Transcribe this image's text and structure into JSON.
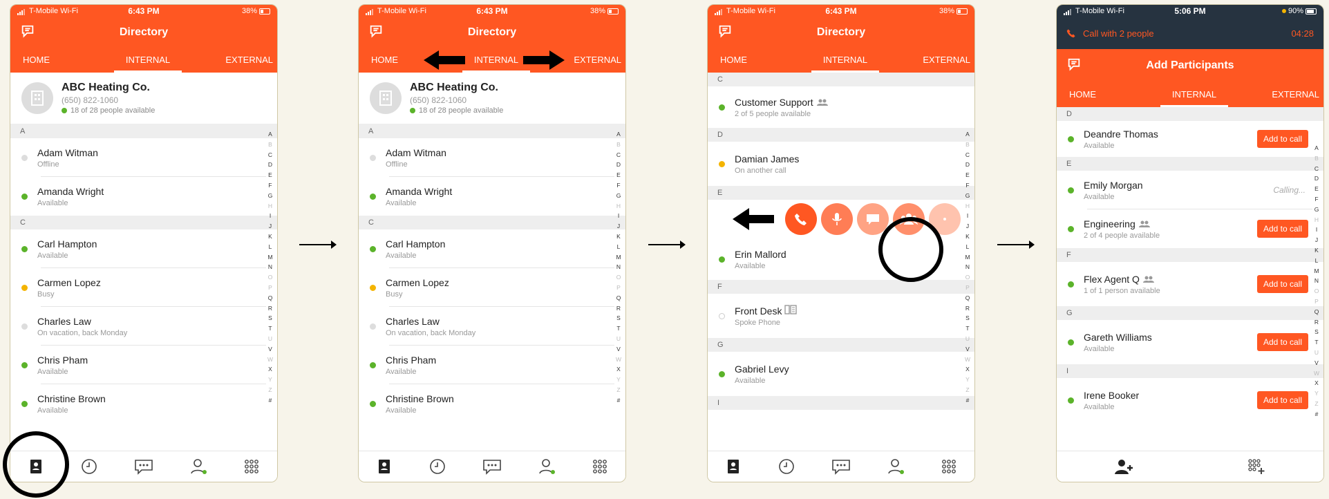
{
  "colors": {
    "accent": "#ff5722",
    "available": "#5bb32a",
    "busy": "#f4b400",
    "offline": "#dddddd",
    "call_bar": "#263340"
  },
  "status_bar": {
    "carrier": "T-Mobile Wi-Fi",
    "time": "6:43 PM",
    "battery": "38%"
  },
  "status_bar_4": {
    "carrier": "T-Mobile Wi-Fi",
    "time": "5:06 PM",
    "battery": "90%"
  },
  "directory": {
    "title": "Directory"
  },
  "tabs": {
    "home": "HOME",
    "internal": "INTERNAL",
    "external": "EXTERNAL"
  },
  "org": {
    "name": "ABC Heating Co.",
    "phone": "(650) 822-1060",
    "availability": "18 of 28 people available"
  },
  "alphabet": [
    "A",
    "B",
    "C",
    "D",
    "E",
    "F",
    "G",
    "H",
    "I",
    "J",
    "K",
    "L",
    "M",
    "N",
    "O",
    "P",
    "Q",
    "R",
    "S",
    "T",
    "U",
    "V",
    "W",
    "X",
    "Y",
    "Z",
    "#"
  ],
  "screen1_contacts": {
    "section_a": "A",
    "section_c": "C",
    "rows": [
      {
        "name": "Adam Witman",
        "status": "Offline"
      },
      {
        "name": "Amanda Wright",
        "status": "Available"
      },
      {
        "name": "Carl Hampton",
        "status": "Available"
      },
      {
        "name": "Carmen Lopez",
        "status": "Busy"
      },
      {
        "name": "Charles Law",
        "status": "On vacation, back Monday"
      },
      {
        "name": "Chris Pham",
        "status": "Available"
      },
      {
        "name": "Christine Brown",
        "status": "Available"
      }
    ]
  },
  "screen3": {
    "sections": {
      "c": "C",
      "d": "D",
      "e": "E",
      "f": "F",
      "g": "G",
      "i": "I"
    },
    "rows": [
      {
        "name": "Customer Support",
        "status": "2 of 5 people available"
      },
      {
        "name": "Damian James",
        "status": "On another call"
      },
      {
        "name": "Erin Mallord",
        "status": "Available"
      },
      {
        "name": "Front Desk",
        "status": "Spoke Phone"
      },
      {
        "name": "Gabriel Levy",
        "status": "Available"
      }
    ]
  },
  "screen4": {
    "call_banner": "Call with 2 people",
    "call_timer": "04:28",
    "title": "Add Participants",
    "add_label": "Add to call",
    "calling_label": "Calling...",
    "sections": {
      "d": "D",
      "e": "E",
      "f": "F",
      "g": "G",
      "i": "I"
    },
    "rows": [
      {
        "name": "Deandre Thomas",
        "status": "Available"
      },
      {
        "name": "Emily Morgan",
        "status": "Available"
      },
      {
        "name": "Engineering",
        "status": "2 of 4 people available"
      },
      {
        "name": "Flex Agent Q",
        "status": "1 of 1 person available"
      },
      {
        "name": "Gareth Williams",
        "status": "Available"
      },
      {
        "name": "Irene Booker",
        "status": "Available"
      }
    ]
  },
  "icons": [
    "directory-icon",
    "history-icon",
    "messages-icon",
    "presence-icon",
    "dialpad-icon",
    "add-person-icon",
    "add-dialpad-icon",
    "phone-icon",
    "mic-icon",
    "chat-icon",
    "group-icon"
  ]
}
